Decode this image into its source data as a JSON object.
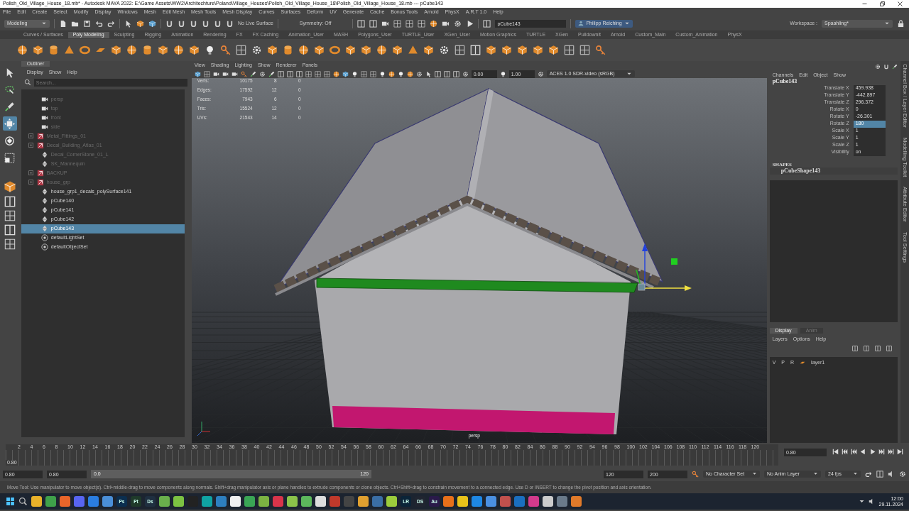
{
  "window": {
    "title": "Polish_Old_Village_House_18.mb* - Autodesk MAYA 2022: E:\\Game Assets\\WW2\\Architechture\\Poland\\Village_Houses\\Polish_Old_Village_House_18\\Polish_Old_Village_House_18.mb  ---  pCube143"
  },
  "menu": [
    "File",
    "Edit",
    "Create",
    "Select",
    "Modify",
    "Display",
    "Windows",
    "Mesh",
    "Edit Mesh",
    "Mesh Tools",
    "Mesh Display",
    "Curves",
    "Surfaces",
    "Deform",
    "UV",
    "Generate",
    "Cache",
    "Bonus Tools",
    "Arnold",
    "PhysX",
    "A.R.T 1.0",
    "Help"
  ],
  "status_line": {
    "mode": "Modeling",
    "live_surface": "No Live Surface",
    "symmetry": "Symmetry: Off",
    "object_field": "pCube143",
    "user": "Philipp Reiching",
    "workspace_label": "Workspace :",
    "workspace": "Spaahling*"
  },
  "shelf_tabs": [
    {
      "label": "Curves / Surfaces",
      "selected": false
    },
    {
      "label": "Poly Modeling",
      "selected": true
    },
    {
      "label": "Sculpting",
      "selected": false
    },
    {
      "label": "Rigging",
      "selected": false
    },
    {
      "label": "Animation",
      "selected": false
    },
    {
      "label": "Rendering",
      "selected": false
    },
    {
      "label": "FX",
      "selected": false
    },
    {
      "label": "FX Caching",
      "selected": false
    },
    {
      "label": "Animation_User",
      "selected": false
    },
    {
      "label": "MASH",
      "selected": false
    },
    {
      "label": "Polygons_User",
      "selected": false
    },
    {
      "label": "TURTLE_User",
      "selected": false
    },
    {
      "label": "XGen_User",
      "selected": false
    },
    {
      "label": "Motion Graphics",
      "selected": false
    },
    {
      "label": "TURTLE",
      "selected": false
    },
    {
      "label": "XGen",
      "selected": false
    },
    {
      "label": "Pulldownit",
      "selected": false
    },
    {
      "label": "Arnold",
      "selected": false
    },
    {
      "label": "Custom_Main",
      "selected": false
    },
    {
      "label": "Custom_Animation",
      "selected": false
    },
    {
      "label": "PhysX",
      "selected": false
    }
  ],
  "tools": [
    {
      "kind": "select",
      "selected": false
    },
    {
      "kind": "lasso",
      "selected": false
    },
    {
      "kind": "paint",
      "selected": false
    },
    {
      "kind": "move",
      "selected": true
    },
    {
      "kind": "rotate",
      "selected": false
    },
    {
      "kind": "scale",
      "selected": false
    }
  ],
  "outliner": {
    "title": "Outliner",
    "menu": [
      "Display",
      "Show",
      "Help"
    ],
    "search_placeholder": "Search...",
    "items": [
      {
        "label": "persp",
        "kind": "camera",
        "hidden": true,
        "selected": false
      },
      {
        "label": "top",
        "kind": "camera",
        "hidden": true,
        "selected": false
      },
      {
        "label": "front",
        "kind": "camera",
        "hidden": true,
        "selected": false
      },
      {
        "label": "side",
        "kind": "camera",
        "hidden": true,
        "selected": false
      },
      {
        "label": "Metal_Fittings_01",
        "kind": "group",
        "hidden": true,
        "selected": false,
        "expanded": false
      },
      {
        "label": "Decal_Building_Atlas_01",
        "kind": "group",
        "hidden": true,
        "selected": false,
        "expanded": false
      },
      {
        "label": "Decal_CornerStone_01_L",
        "kind": "mesh",
        "hidden": true,
        "selected": false
      },
      {
        "label": "SK_Mannequin",
        "kind": "mesh",
        "hidden": true,
        "selected": false
      },
      {
        "label": "BACKUP",
        "kind": "group",
        "hidden": true,
        "selected": false,
        "expanded": false
      },
      {
        "label": "house_grp",
        "kind": "group",
        "hidden": true,
        "selected": false,
        "expanded": false
      },
      {
        "label": "house_grp1_decals_polySurface141",
        "kind": "mesh",
        "hidden": false,
        "selected": false
      },
      {
        "label": "pCube140",
        "kind": "mesh",
        "hidden": false,
        "selected": false
      },
      {
        "label": "pCube141",
        "kind": "mesh",
        "hidden": false,
        "selected": false
      },
      {
        "label": "pCube142",
        "kind": "mesh",
        "hidden": false,
        "selected": false
      },
      {
        "label": "pCube143",
        "kind": "mesh",
        "hidden": false,
        "selected": true
      },
      {
        "label": "defaultLightSet",
        "kind": "set",
        "hidden": false,
        "selected": false
      },
      {
        "label": "defaultObjectSet",
        "kind": "set",
        "hidden": false,
        "selected": false
      }
    ]
  },
  "viewport": {
    "menu": [
      "View",
      "Shading",
      "Lighting",
      "Show",
      "Renderer",
      "Panels"
    ],
    "exposure": "0.00",
    "gamma": "1.00",
    "color_space": "ACES 1.0 SDR-video (sRGB)",
    "camera": "persp",
    "hud": [
      {
        "label": "Verts:",
        "values": [
          "10175",
          "8",
          "0"
        ]
      },
      {
        "label": "Edges:",
        "values": [
          "17592",
          "12",
          "0"
        ]
      },
      {
        "label": "Faces:",
        "values": [
          "7943",
          "6",
          "0"
        ]
      },
      {
        "label": "Tris:",
        "values": [
          "15524",
          "12",
          "0"
        ]
      },
      {
        "label": "UVs:",
        "values": [
          "21543",
          "14",
          "0"
        ]
      }
    ]
  },
  "channel_box": {
    "menu": [
      "Channels",
      "Edit",
      "Object",
      "Show"
    ],
    "object": "pCube143",
    "channels": [
      {
        "name": "Translate X",
        "value": "459.938",
        "selected": false
      },
      {
        "name": "Translate Y",
        "value": "-442.897",
        "selected": false
      },
      {
        "name": "Translate Z",
        "value": "296.372",
        "selected": false
      },
      {
        "name": "Rotate X",
        "value": "0",
        "selected": false
      },
      {
        "name": "Rotate Y",
        "value": "-26.301",
        "selected": false
      },
      {
        "name": "Rotate Z",
        "value": "180",
        "selected": true
      },
      {
        "name": "Scale X",
        "value": "1",
        "selected": false
      },
      {
        "name": "Scale Y",
        "value": "1",
        "selected": false
      },
      {
        "name": "Scale Z",
        "value": "1",
        "selected": false
      },
      {
        "name": "Visibility",
        "value": "on",
        "selected": false
      }
    ],
    "shapes_title": "SHAPES",
    "shape": "pCubeShape143",
    "layer_tabs": [
      {
        "label": "Display",
        "selected": true
      },
      {
        "label": "Anim",
        "selected": false
      }
    ],
    "layer_menu": [
      "Layers",
      "Options",
      "Help"
    ],
    "layers": [
      {
        "flags": [
          "V",
          "P",
          "R"
        ],
        "name": "layer1"
      }
    ],
    "side_tabs": [
      "Channel Box / Layer Editor",
      "Modelling Toolkit",
      "Attribute Editor",
      "Tool Settings"
    ]
  },
  "timeline": {
    "ticks": [
      "2",
      "4",
      "6",
      "8",
      "10",
      "12",
      "14",
      "16",
      "18",
      "20",
      "22",
      "24",
      "26",
      "28",
      "30",
      "32",
      "34",
      "36",
      "38",
      "40",
      "42",
      "44",
      "46",
      "48",
      "50",
      "52",
      "54",
      "56",
      "58",
      "60",
      "62",
      "64",
      "66",
      "68",
      "70",
      "72",
      "74",
      "76",
      "78",
      "80",
      "82",
      "84",
      "86",
      "88",
      "90",
      "92",
      "94",
      "96",
      "98",
      "100",
      "102",
      "104",
      "106",
      "108",
      "110",
      "112",
      "114",
      "116",
      "118",
      "120"
    ],
    "current": "0.80",
    "frame_field": "0.80"
  },
  "range": {
    "level": 1,
    "start": "0.80",
    "anim_start": "0.80",
    "range_start": "0.0",
    "range_end": "120",
    "anim_end_field": "120",
    "end_field": "200",
    "character_set": "No Character Set",
    "anim_layer": "No Anim Layer",
    "fps": "24 fps"
  },
  "help_line": "Move Tool: Use manipulator to move object(s). Ctrl+middle-drag to move components along normals. Shift+drag manipulator axis or plane handles to extrude components or clone objects. Ctrl+Shift+drag to constrain movement to a connected edge. Use D or INSERT to change the pivot position and axis orientation.",
  "taskbar": {
    "time": "12:00",
    "date": "29.11.2024",
    "apps": [
      {
        "color": "#e8b12a"
      },
      {
        "color": "#3fa14a"
      },
      {
        "color": "#e8652a"
      },
      {
        "color": "#5865f2"
      },
      {
        "color": "#2a7de1"
      },
      {
        "color": "#4a8fd8"
      },
      {
        "label": "Ps",
        "color": "#0b2e4f"
      },
      {
        "label": "Pt",
        "color": "#1f3a2a"
      },
      {
        "label": "Ds",
        "color": "#1f2f40"
      },
      {
        "color": "#6ab04c"
      },
      {
        "color": "#7cc242"
      },
      {
        "color": "#222222"
      },
      {
        "color": "#0fa3a3"
      },
      {
        "color": "#2d7fc0"
      },
      {
        "color": "#f0f0f0"
      },
      {
        "color": "#3aa655"
      },
      {
        "color": "#7cb342"
      },
      {
        "color": "#d9344a"
      },
      {
        "color": "#8bc34a"
      },
      {
        "color": "#5cb85c"
      },
      {
        "color": "#dddddd"
      },
      {
        "color": "#c0392b"
      },
      {
        "color": "#444444"
      },
      {
        "color": "#e0a030"
      },
      {
        "color": "#3a6ea5"
      },
      {
        "color": "#9ccc3c"
      },
      {
        "label": "LR",
        "color": "#0b2438"
      },
      {
        "label": "DS",
        "color": "#202530"
      },
      {
        "label": "Au",
        "color": "#2a1a4a"
      },
      {
        "color": "#e8701a"
      },
      {
        "color": "#e8c21a"
      },
      {
        "color": "#1e88e5"
      },
      {
        "color": "#4a90e2"
      },
      {
        "color": "#c0504d"
      },
      {
        "color": "#1a6fc0"
      },
      {
        "color": "#d23a8c"
      },
      {
        "color": "#cccccc"
      },
      {
        "color": "#6a7a8a"
      },
      {
        "color": "#e07a2a"
      }
    ]
  }
}
